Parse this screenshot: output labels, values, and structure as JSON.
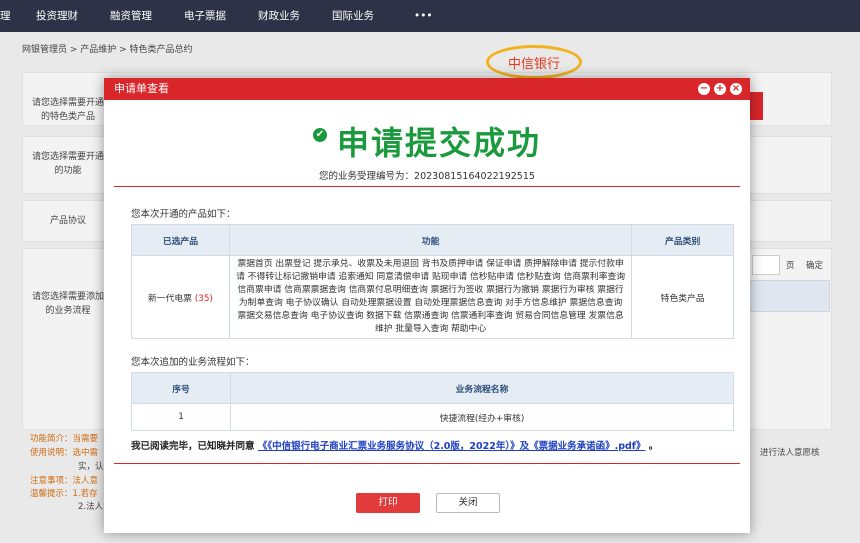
{
  "nav": {
    "items": [
      "理",
      "投资理财",
      "融资管理",
      "电子票据",
      "财政业务",
      "国际业务",
      "•••"
    ]
  },
  "breadcrumb": "网银管理员 > 产品维护 > 特色类产品总约",
  "bank_label": "中信银行",
  "background": {
    "rows": [
      "请您选择需要开通\n的特色类产品",
      "请您选择需要开通\n的功能",
      "产品协议",
      "请您选择需要添加\n的业务流程"
    ],
    "page_unit": "页",
    "confirm": "确定",
    "func_intro": "功能简介：当需要",
    "usage": "使用说明：选中需",
    "usage2": "实，认",
    "note": "注意事项：法人意",
    "tip": "温馨提示：1.若存",
    "tip2": "2.法人",
    "right_text": "进行法人意愿核"
  },
  "modal": {
    "title": "申请单查看",
    "header_buttons": [
      "minimize-icon",
      "maximize-icon",
      "close-icon"
    ],
    "success_title": "申请提交成功",
    "ref_text": "您的业务受理编号为：20230815164022192515",
    "products_label": "您本次开通的产品如下：",
    "products_table": {
      "headers": [
        "已选产品",
        "功能",
        "产品类别"
      ],
      "product": "新一代电票",
      "count": "(35)",
      "functions": "票据首页 出票登记 提示承兑、收票及未用退回 背书及质押申请 保证申请 质押解除申请 提示付款申请 不得转让标记撤销申请 追索通知 同意清偿申请 贴现申请 信秒贴申请 信秒贴查询 信商票利率查询 信商票申请 信商票票据查询 信商票付息明细查询 票据行为签收 票据行为撤销 票据行为审核 票据行为制单查询 电子协议确认 自动处理票据设置 自动处理票据信息查询 对手方信息维护 票据信息查询 票据交易信息查询 电子协议查询 数据下载 信票通查询 信票通利率查询 贸易合同信息管理 发票信息维护 批量导入查询 帮助中心",
      "category": "特色类产品"
    },
    "flow_label": "您本次追加的业务流程如下：",
    "flow_table": {
      "headers": [
        "序号",
        "业务流程名称"
      ],
      "rows": [
        {
          "index": "1",
          "name": "快捷流程(经办+审核)"
        }
      ]
    },
    "agree_prefix": "我已阅读完毕，已知晓并同意",
    "agree_links": "《《中信银行电子商业汇票业务服务协议（2.0版，2022年）》及《票据业务承诺函》.pdf》",
    "agree_suffix": "。",
    "print_button": "打印",
    "close_button": "关闭"
  }
}
